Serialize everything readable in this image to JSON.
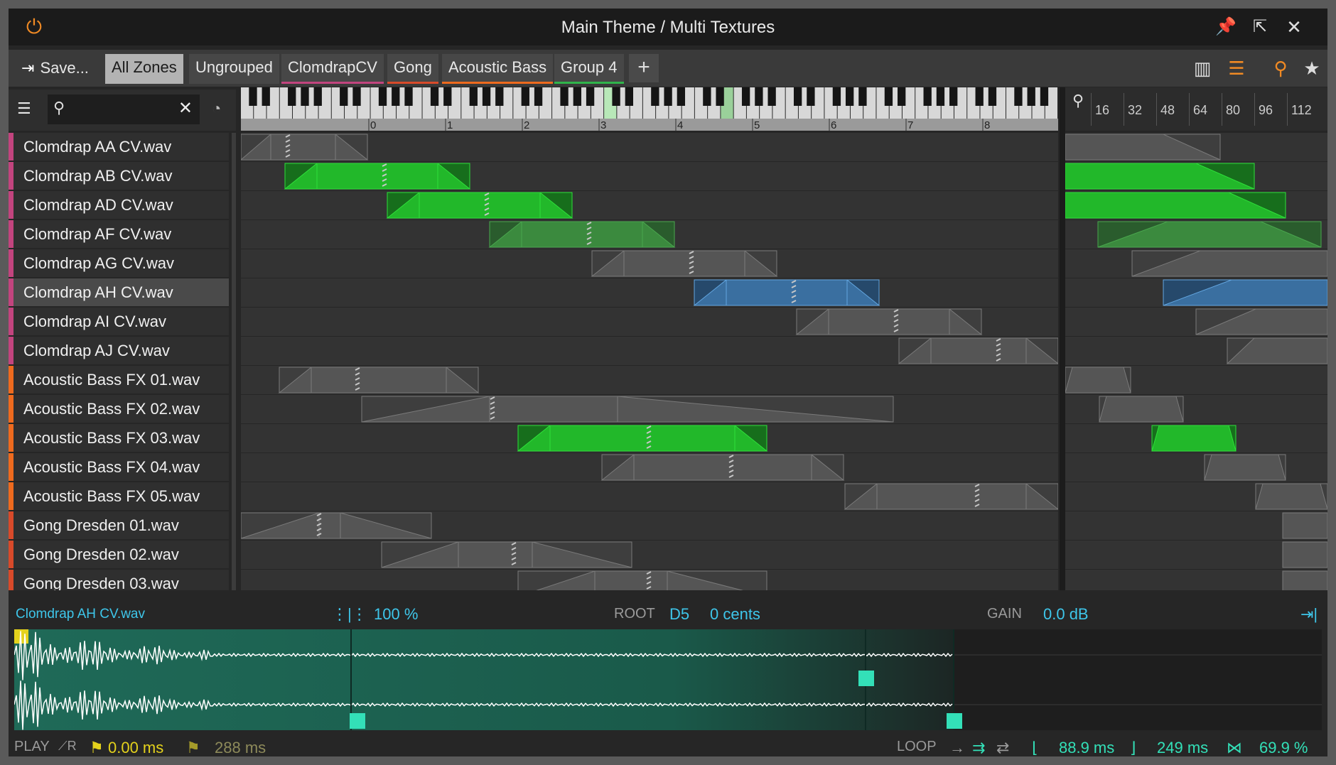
{
  "window": {
    "title": "Main Theme / Multi Textures",
    "icons": {
      "power": "power-icon",
      "pin": "pin-icon",
      "popout": "popout-icon",
      "close": "close-icon"
    }
  },
  "toolbar": {
    "save_label": "Save...",
    "tabs": [
      {
        "label": "All Zones",
        "active": true,
        "color": ""
      },
      {
        "label": "Ungrouped",
        "active": false,
        "color": ""
      },
      {
        "label": "ClomdrapCV",
        "active": false,
        "color": "#c2447e"
      },
      {
        "label": "Gong",
        "active": false,
        "color": "#d84a2a"
      },
      {
        "label": "Acoustic Bass",
        "active": false,
        "color": "#ee6a1e"
      },
      {
        "label": "Group 4",
        "active": false,
        "color": "#2fb44a"
      }
    ],
    "add_label": "+"
  },
  "keyboard": {
    "octaves": [
      "0",
      "1",
      "2",
      "3",
      "4",
      "5",
      "6",
      "7",
      "8"
    ]
  },
  "velocity": {
    "ticks": [
      "16",
      "32",
      "48",
      "64",
      "80",
      "96",
      "112"
    ]
  },
  "zones": [
    {
      "name": "Clomdrap AA CV.wav",
      "group_color": "#c2447e",
      "state": "gray"
    },
    {
      "name": "Clomdrap AB CV.wav",
      "group_color": "#c2447e",
      "state": "green"
    },
    {
      "name": "Clomdrap AD CV.wav",
      "group_color": "#c2447e",
      "state": "green"
    },
    {
      "name": "Clomdrap AF CV.wav",
      "group_color": "#c2447e",
      "state": "green-dim"
    },
    {
      "name": "Clomdrap AG CV.wav",
      "group_color": "#c2447e",
      "state": "gray"
    },
    {
      "name": "Clomdrap AH CV.wav",
      "group_color": "#c2447e",
      "state": "blue",
      "selected": true
    },
    {
      "name": "Clomdrap AI CV.wav",
      "group_color": "#c2447e",
      "state": "gray"
    },
    {
      "name": "Clomdrap AJ CV.wav",
      "group_color": "#c2447e",
      "state": "gray"
    },
    {
      "name": "Acoustic Bass FX 01.wav",
      "group_color": "#ee6a1e",
      "state": "gray"
    },
    {
      "name": "Acoustic Bass FX 02.wav",
      "group_color": "#ee6a1e",
      "state": "gray"
    },
    {
      "name": "Acoustic Bass FX 03.wav",
      "group_color": "#ee6a1e",
      "state": "green"
    },
    {
      "name": "Acoustic Bass FX 04.wav",
      "group_color": "#ee6a1e",
      "state": "gray"
    },
    {
      "name": "Acoustic Bass FX 05.wav",
      "group_color": "#ee6a1e",
      "state": "gray"
    },
    {
      "name": "Gong Dresden 01.wav",
      "group_color": "#d84a2a",
      "state": "gray"
    },
    {
      "name": "Gong Dresden 02.wav",
      "group_color": "#d84a2a",
      "state": "gray"
    },
    {
      "name": "Gong Dresden 03.wav",
      "group_color": "#d84a2a",
      "state": "gray"
    }
  ],
  "editor": {
    "sample_name": "Clomdrap AH CV.wav",
    "speed": "100 %",
    "root_label": "ROOT",
    "root_note": "D5",
    "cents": "0 cents",
    "gain_label": "GAIN",
    "gain_value": "0.0 dB",
    "play_label": "PLAY",
    "play_start": "0.00 ms",
    "play_end": "288 ms",
    "loop_label": "LOOP",
    "loop_start": "88.9 ms",
    "loop_length": "249 ms",
    "crossfade": "69.9 %",
    "colors": {
      "accent": "#3ec6ea",
      "loop": "#33e0b8",
      "play": "#e4d21c"
    }
  }
}
